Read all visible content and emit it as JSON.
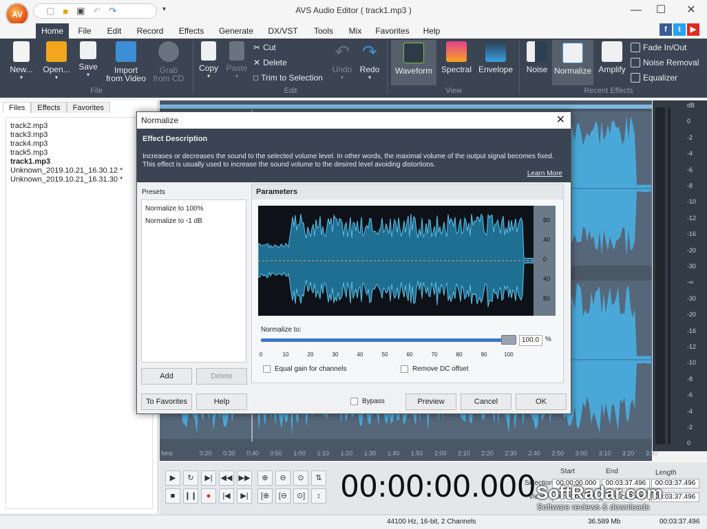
{
  "app": {
    "title": "AVS Audio Editor ( track1.mp3 )",
    "logo_text": "AV"
  },
  "menu": [
    "Home",
    "File",
    "Edit",
    "Record",
    "Effects",
    "Generate",
    "DX/VST",
    "Tools",
    "Mix",
    "Favorites",
    "Help"
  ],
  "ribbon": {
    "file_group": {
      "label": "File",
      "buttons": [
        "New...",
        "Open...",
        "Save",
        "Import\nfrom Video",
        "Grab\nfrom CD"
      ]
    },
    "edit_group": {
      "label": "Edit",
      "big": [
        "Copy",
        "Paste",
        "Undo",
        "Redo"
      ],
      "small": [
        "Cut",
        "Delete",
        "Trim to Selection"
      ]
    },
    "view_group": {
      "label": "View",
      "buttons": [
        "Waveform",
        "Spectral",
        "Envelope"
      ]
    },
    "recent_group": {
      "label": "Recent Effects",
      "buttons": [
        "Noise",
        "Normalize",
        "Amplify"
      ],
      "small": [
        "Fade In/Out",
        "Noise Removal",
        "Equalizer"
      ]
    }
  },
  "left_panel": {
    "tabs": [
      "Files",
      "Effects",
      "Favorites"
    ],
    "files": [
      "track2.mp3",
      "track3.mp3",
      "track4.mp3",
      "track5.mp3",
      "track1.mp3",
      "Unknown_2019.10.21_16.30.12 *",
      "Unknown_2019.10.21_16.31.30 *"
    ],
    "current_index": 4
  },
  "db_scale": [
    "dB",
    "0",
    "-2",
    "-4",
    "-6",
    "-8",
    "-10",
    "-12",
    "-16",
    "-20",
    "-30",
    "-∞",
    "-30",
    "-20",
    "-16",
    "-12",
    "-10",
    "-8",
    "-6",
    "-4",
    "-2",
    "0"
  ],
  "ruler_labels": [
    "hms",
    "0:20",
    "0:30",
    "0:40",
    "0:50",
    "1:00",
    "1:10",
    "1:20",
    "1:30",
    "1:40",
    "1:50",
    "2:00",
    "2:10",
    "2:20",
    "2:30",
    "2:40",
    "2:50",
    "3:00",
    "3:10",
    "3:20",
    "3:30"
  ],
  "transport": {
    "timecode": "00:00:00.000",
    "selection_label": "Selection",
    "view_label": "View",
    "start_label": "Start",
    "end_label": "End",
    "length_label": "Length",
    "selection": {
      "start": "00:00:00.000",
      "end": "00:03:37.496",
      "length": "00:03:37.496"
    },
    "view": {
      "start": "00:00:00.000",
      "end": "00:03:37.496",
      "length": "00:03:37.496"
    }
  },
  "status": {
    "format": "44100 Hz, 16-bit, 2 Channels",
    "size": "36.589 Mb",
    "duration": "00:03:37.496"
  },
  "dialog": {
    "title": "Normalize",
    "desc_title": "Effect Description",
    "desc_text": "Increases or decreases the sound to the selected volume level. In other words, the maximal volume of the output signal becomes fixed. This effect is usually used to increase the sound volume to the desired level avoiding distortions.",
    "learn_more": "Learn More",
    "presets_label": "Presets",
    "presets": [
      "Normalize to 100%",
      "Normalize to -1 dB"
    ],
    "add": "Add",
    "delete": "Delete",
    "params_label": "Parameters",
    "wave_scale": [
      "80",
      "40",
      "0",
      "40",
      "80"
    ],
    "normalize_label": "Normalize to:",
    "normalize_value": "100.0",
    "normalize_percent": 100,
    "normalize_unit": "%",
    "ticks": [
      "0",
      "10",
      "20",
      "30",
      "40",
      "50",
      "60",
      "70",
      "80",
      "90",
      "100"
    ],
    "equal_gain": "Equal gain for channels",
    "remove_dc": "Remove DC offset",
    "to_favorites": "To Favorites",
    "help": "Help",
    "bypass": "Bypass",
    "preview": "Preview",
    "cancel": "Cancel",
    "ok": "OK"
  },
  "watermark": {
    "title": "SoftRadar.com",
    "subtitle": "Software reviews & downloads"
  },
  "colors": {
    "ribbon": "#3a4452",
    "wave": "#4aa8d8",
    "wave_bg": "#4a5866"
  }
}
